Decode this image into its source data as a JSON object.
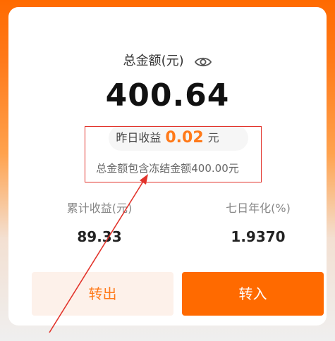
{
  "total": {
    "label": "总金额(元)",
    "amount": "400.64",
    "eye_icon": "eye-icon"
  },
  "yesterday": {
    "label": "昨日收益",
    "value": "0.02",
    "unit": "元"
  },
  "frozen_note": "总金额包含冻结金额400.00元",
  "stats": {
    "cumulative_label": "累计收益(元)",
    "cumulative_value": "89.33",
    "seven_day_label": "七日年化(%)",
    "seven_day_value": "1.9370"
  },
  "buttons": {
    "transfer_out": "转出",
    "transfer_in": "转入"
  },
  "colors": {
    "accent": "#ff6a00",
    "highlight": "#ff7a1a",
    "annotation_red": "#e2332b"
  }
}
